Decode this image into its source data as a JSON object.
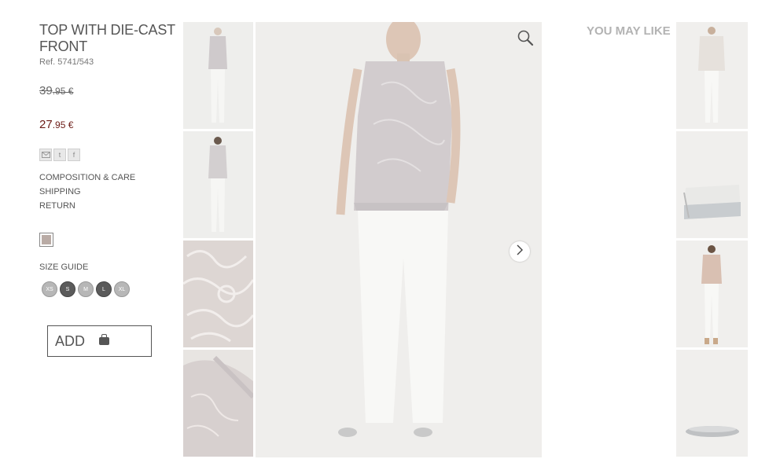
{
  "product": {
    "title": "TOP WITH DIE-CAST FRONT",
    "ref": "Ref. 5741/543",
    "old_price_int": "39",
    "old_price_dec": ".95 €",
    "new_price_int": "27",
    "new_price_dec": ".95 €"
  },
  "share": [
    "mail-icon",
    "twitter-icon",
    "facebook-icon"
  ],
  "links": {
    "composition": "COMPOSITION & CARE",
    "shipping": "SHIPPING",
    "return": "RETURN"
  },
  "colors": {
    "swatch": "#b9aba5",
    "price": "#6d1c17"
  },
  "size_guide": "SIZE GUIDE",
  "sizes": [
    "XS",
    "S",
    "M",
    "L",
    "XL"
  ],
  "add_label": "ADD",
  "you_may_like": "YOU MAY LIKE"
}
